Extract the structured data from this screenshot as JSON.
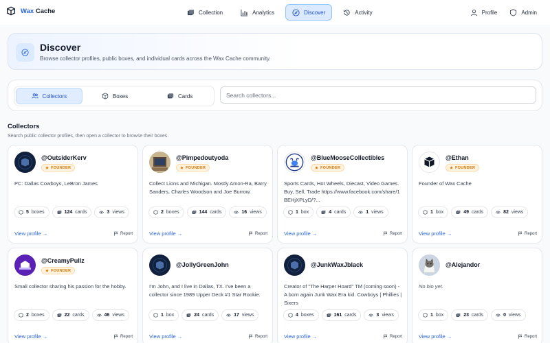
{
  "app": {
    "name_part1": "Wax",
    "name_part2": "Cache"
  },
  "nav": {
    "collection": "Collection",
    "analytics": "Analytics",
    "discover": "Discover",
    "activity": "Activity",
    "profile": "Profile",
    "admin": "Admin"
  },
  "header": {
    "title": "Discover",
    "subtitle": "Browse collector profiles, public boxes, and individual cards across the Wax Cache community."
  },
  "filter": {
    "tabs": [
      "Collectors",
      "Boxes",
      "Cards"
    ],
    "active_tab": "Collectors",
    "search_placeholder": "Search collectors..."
  },
  "section": {
    "title": "Collectors",
    "subtitle": "Search public collector profiles, then open a collector to browse their boxes."
  },
  "labels": {
    "founder": "FOUNDER",
    "view_profile": "View profile →",
    "report": "Report"
  },
  "colors": {
    "accent": "#2563eb",
    "badge": "#d97706"
  },
  "collectors": [
    {
      "username": "@OutsiderKerv",
      "founder": true,
      "bio": "PC: Dallas Cowboys, LeBron James",
      "boxes": "5",
      "boxes_label": "boxes",
      "cards": "124",
      "views": "3",
      "avatar": "dark-logo-avatar"
    },
    {
      "username": "@Pimpedoutyoda",
      "founder": true,
      "bio": "Collect Lions and Michigan. Mostly Amon-Ra, Barry Sanders, Charles Woodson and Joe Burrow.",
      "boxes": "2",
      "boxes_label": "boxes",
      "cards": "144",
      "views": "16",
      "avatar": "photo-avatar"
    },
    {
      "username": "@BlueMooseCollectibles",
      "founder": true,
      "bio": "Sports Cards, Hot Wheels, Diecast, Video Games. Buy, Sell, Trade https://www.facebook.com/share/1BEHjXPLyD/?...",
      "boxes": "1",
      "boxes_label": "box",
      "cards": "4",
      "views": "1",
      "avatar": "moose-logo-avatar"
    },
    {
      "username": "@Ethan",
      "founder": true,
      "bio": "Founder of Wax Cache",
      "boxes": "1",
      "boxes_label": "box",
      "cards": "49",
      "views": "82",
      "avatar": "wax-logo-avatar"
    },
    {
      "username": "@CreamyPullz",
      "founder": true,
      "bio": "Small collector sharing his passion for the hobby.",
      "boxes": "2",
      "boxes_label": "boxes",
      "cards": "22",
      "views": "46",
      "avatar": "creamy-logo-avatar"
    },
    {
      "username": "@JollyGreenJohn",
      "founder": false,
      "bio": "I'm John, and I live in Dallas, TX. I've been a collector since 1989 Upper Deck #1 Star Rookie.",
      "boxes": "1",
      "boxes_label": "box",
      "cards": "24",
      "views": "17",
      "avatar": "dark-logo-avatar"
    },
    {
      "username": "@JunkWaxJblack",
      "founder": false,
      "bio": "Creator of \"The Harper Hoard\" TM (coming soon) - A born again Junk Wax Era kid. Cowboys | Phillies | Sixers",
      "boxes": "4",
      "boxes_label": "boxes",
      "cards": "161",
      "views": "3",
      "avatar": "dark-logo-avatar"
    },
    {
      "username": "@Alejandor",
      "founder": false,
      "bio": "No bio yet.",
      "boxes": "1",
      "boxes_label": "box",
      "cards": "23",
      "views": "0",
      "avatar": "cat-photo-avatar"
    }
  ]
}
